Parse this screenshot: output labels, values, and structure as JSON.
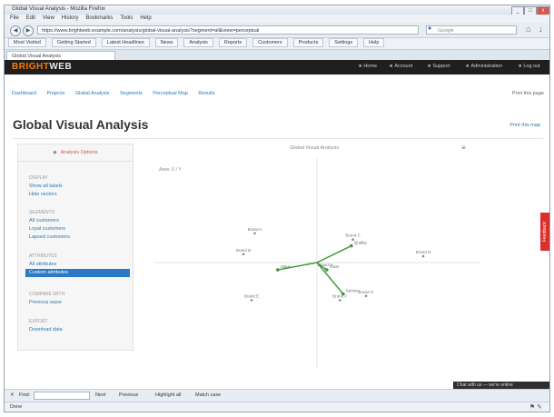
{
  "window": {
    "title": "Global Visual Analysis - Mozilla Firefox",
    "min_label": "_",
    "max_label": "□",
    "close_label": "x"
  },
  "menu": [
    "File",
    "Edit",
    "View",
    "History",
    "Bookmarks",
    "Tools",
    "Help"
  ],
  "nav": {
    "back_label": "◀",
    "forward_label": "▶",
    "url": "https://www.brightweb.example.com/analysis/global-visual-analysis?segment=all&view=perceptual",
    "search_placeholder": "Google"
  },
  "bookmarks": [
    "Most Visited",
    "Getting Started",
    "Latest Headlines",
    "News",
    "Analysis",
    "Reports",
    "Customers",
    "Products",
    "Settings",
    "Help"
  ],
  "tab": {
    "label": "Global Visual Analysis"
  },
  "site": {
    "logo_a": "BRIGHT",
    "logo_b": "WEB",
    "topnav": [
      "Home",
      "Account",
      "Support",
      "Administration",
      "Log out"
    ],
    "breadcrumbs": [
      "Dashboard",
      "Projects",
      "Global Analysis",
      "Segments",
      "Perceptual Map",
      "Results"
    ],
    "page_url_text": "Print this page",
    "page_title": "Global Visual Analysis",
    "print_link": "Print this map"
  },
  "left_panel": {
    "header": "Analysis Options",
    "groups": [
      {
        "title": "DISPLAY",
        "links": [
          "Show all labels",
          "Hide vectors"
        ]
      },
      {
        "title": "SEGMENTS",
        "links": [
          "All customers",
          "Loyal customers",
          "Lapsed customers"
        ]
      },
      {
        "title": "ATTRIBUTES",
        "links": [
          "All attributes",
          "Custom attributes"
        ]
      },
      {
        "title": "COMPARE WITH",
        "links": [
          "Previous wave"
        ]
      },
      {
        "title": "EXPORT",
        "links": [
          "Download data"
        ]
      }
    ],
    "active_item": "Custom attributes"
  },
  "chart_data": {
    "type": "scatter",
    "title": "Global Visual Analysis",
    "axis_note": "Axes: X / Y",
    "xlim": [
      -1,
      1
    ],
    "ylim": [
      -1,
      1
    ],
    "grid": false,
    "points": [
      {
        "label": "Brand A",
        "x": -0.38,
        "y": 0.28
      },
      {
        "label": "Brand B",
        "x": -0.45,
        "y": 0.08
      },
      {
        "label": "Brand C",
        "x": 0.22,
        "y": 0.22
      },
      {
        "label": "Brand D",
        "x": 0.65,
        "y": 0.06
      },
      {
        "label": "Brand E",
        "x": -0.4,
        "y": -0.36
      },
      {
        "label": "Brand F",
        "x": 0.14,
        "y": -0.36
      },
      {
        "label": "Brand G",
        "x": 0.3,
        "y": -0.32
      },
      {
        "label": "Brand H",
        "x": 0.05,
        "y": -0.06
      }
    ],
    "vectors": [
      {
        "label": "Quality",
        "x": 0.21,
        "y": 0.16
      },
      {
        "label": "Value",
        "x": -0.24,
        "y": -0.07
      },
      {
        "label": "Service",
        "x": 0.16,
        "y": -0.3
      },
      {
        "label": "Trust",
        "x": 0.06,
        "y": -0.07
      }
    ],
    "colors": {
      "vector": "#3a9a3a",
      "point": "#888888",
      "axis": "#dddddd"
    }
  },
  "feedback_label": "Feedback",
  "chat_label": "Chat with us — we're online",
  "findbar": {
    "label": "Find:",
    "next": "Next",
    "previous": "Previous",
    "highlight": "Highlight all",
    "match_case": "Match case"
  },
  "status": {
    "text": "Done"
  }
}
